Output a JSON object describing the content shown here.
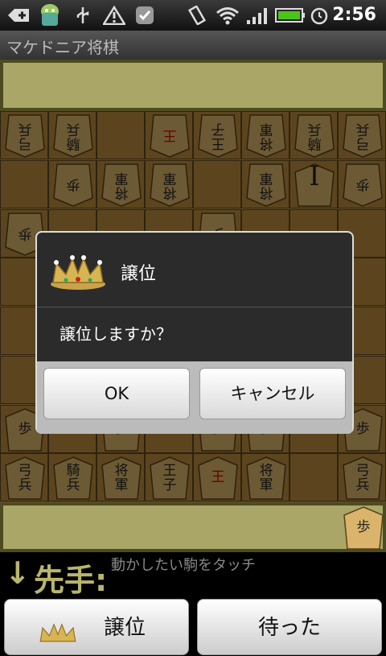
{
  "status_bar": {
    "time": "2:56",
    "icons": [
      "add-icon",
      "android-icon",
      "usb-icon",
      "warning-icon",
      "notification-icon",
      "vibrate-icon",
      "wifi-icon",
      "signal-icon",
      "battery-icon",
      "alarm-icon"
    ],
    "battery_color": "#4cc417"
  },
  "app": {
    "title": "マケドニア将棋"
  },
  "board": {
    "rows": [
      [
        {
          "c": "弓\n兵",
          "u": true
        },
        {
          "c": "騎\n兵",
          "u": true
        },
        null,
        {
          "c": "王",
          "u": true,
          "red": true
        },
        {
          "c": "王\n子",
          "u": true
        },
        {
          "c": "将\n軍",
          "u": true
        },
        {
          "c": "騎\n兵",
          "u": true
        },
        {
          "c": "弓\n兵",
          "u": true
        }
      ],
      [
        null,
        {
          "c": "歩",
          "u": true
        },
        {
          "c": "将\n軍",
          "u": true
        },
        {
          "c": "将\n軍",
          "u": true
        },
        null,
        {
          "c": "将\n軍",
          "u": true
        },
        {
          "c": "I",
          "u": false,
          "big": true
        },
        {
          "c": "歩",
          "u": true
        }
      ],
      [
        {
          "c": "歩",
          "u": true
        },
        null,
        null,
        null,
        {
          "c": "歩",
          "u": true
        },
        null,
        null,
        null
      ],
      [
        null,
        null,
        null,
        null,
        null,
        null,
        null,
        null
      ],
      [
        null,
        null,
        null,
        null,
        null,
        null,
        null,
        null
      ],
      [
        null,
        null,
        null,
        null,
        null,
        null,
        null,
        null
      ],
      [
        {
          "c": "歩",
          "u": false
        },
        null,
        {
          "c": "歩",
          "u": false
        },
        null,
        {
          "c": "歩",
          "u": false
        },
        {
          "c": "歩",
          "u": false
        },
        null,
        {
          "c": "歩",
          "u": false
        }
      ],
      [
        {
          "c": "弓\n兵",
          "u": false
        },
        {
          "c": "騎\n兵",
          "u": false
        },
        {
          "c": "将\n軍",
          "u": false
        },
        {
          "c": "王\n子",
          "u": false
        },
        {
          "c": "王",
          "u": false,
          "red": true
        },
        {
          "c": "将\n軍",
          "u": false
        },
        null,
        {
          "c": "弓\n兵",
          "u": false
        }
      ]
    ]
  },
  "captured_bottom": [
    {
      "c": "歩"
    }
  ],
  "dialog": {
    "title": "譲位",
    "message": "譲位しますか？",
    "ok": "OK",
    "cancel": "キャンセル"
  },
  "turn": {
    "arrow": "↓",
    "label": "先手:",
    "hint": "動かしたい駒をタッチ"
  },
  "buttons": {
    "resign": "譲位",
    "undo": "待った"
  }
}
